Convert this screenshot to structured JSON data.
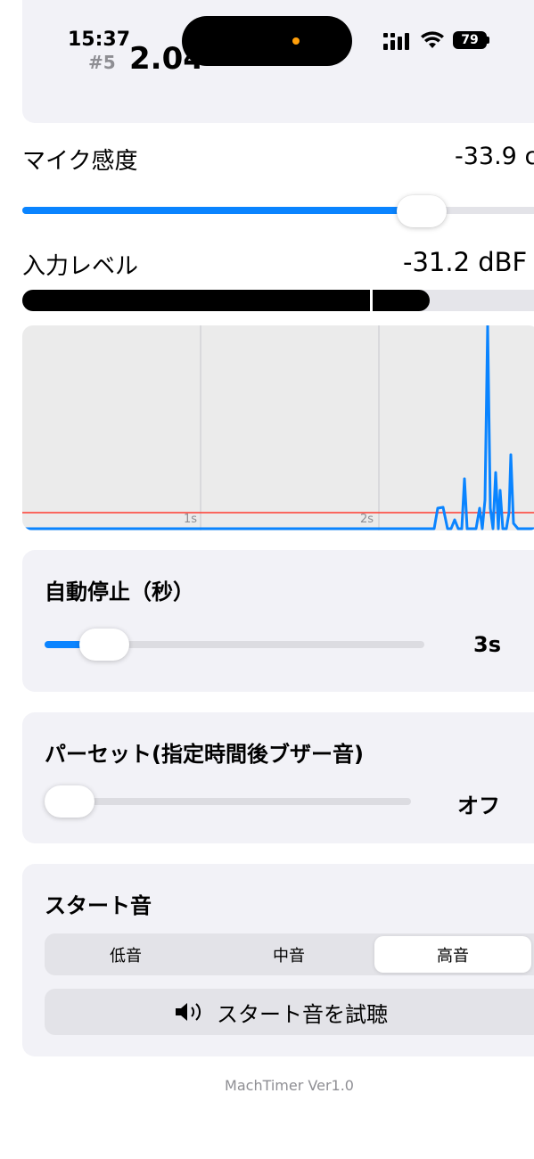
{
  "status_bar": {
    "time": "15:37",
    "battery": "79",
    "signal_icon": "cellular-signal-icon",
    "wifi_icon": "wifi-icon"
  },
  "lap": {
    "index": "#5",
    "time": "2.04"
  },
  "mic_sensitivity": {
    "label": "マイク感度",
    "value": "-33.9 c",
    "slider_fraction": 0.75
  },
  "input_level": {
    "label": "入力レベル",
    "value": "-31.2 dBF",
    "level_fraction": 0.76,
    "threshold_fraction": 0.65
  },
  "waveform": {
    "tick_labels": [
      "1s",
      "2s"
    ],
    "threshold_color": "#ff3b30",
    "line_color": "#0a84ff"
  },
  "auto_stop": {
    "title": "自動停止（秒）",
    "value": "3s",
    "slider_fraction": 0.1
  },
  "preset": {
    "title": "パーセット(指定時間後ブザー音)",
    "value": "オフ",
    "slider_fraction": 0.0
  },
  "start_sound": {
    "title": "スタート音",
    "options": [
      "低音",
      "中音",
      "高音"
    ],
    "selected": "高音",
    "preview_label": "スタート音を試聴",
    "preview_icon": "speaker-icon"
  },
  "footer": {
    "version": "MachTimer Ver1.0"
  },
  "colors": {
    "accent": "#0a84ff",
    "card_bg": "#f2f2f7",
    "level_bar": "#000000"
  }
}
